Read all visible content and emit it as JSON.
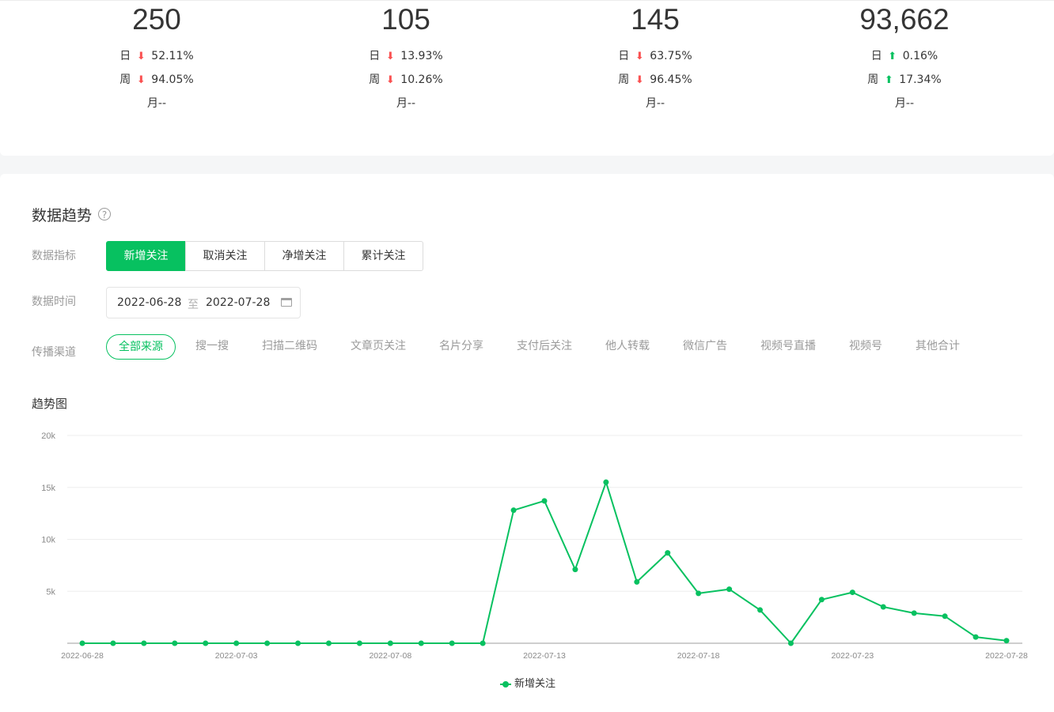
{
  "stats": [
    {
      "value": "250",
      "day_label": "日",
      "day_dir": "down",
      "day_pct": "52.11%",
      "week_label": "周",
      "week_dir": "down",
      "week_pct": "94.05%",
      "month": "月--"
    },
    {
      "value": "105",
      "day_label": "日",
      "day_dir": "down",
      "day_pct": "13.93%",
      "week_label": "周",
      "week_dir": "down",
      "week_pct": "10.26%",
      "month": "月--"
    },
    {
      "value": "145",
      "day_label": "日",
      "day_dir": "down",
      "day_pct": "63.75%",
      "week_label": "周",
      "week_dir": "down",
      "week_pct": "96.45%",
      "month": "月--"
    },
    {
      "value": "93,662",
      "day_label": "日",
      "day_dir": "up",
      "day_pct": "0.16%",
      "week_label": "周",
      "week_dir": "up",
      "week_pct": "17.34%",
      "month": "月--"
    }
  ],
  "trend": {
    "title": "数据趋势",
    "help_icon": "question-circle-icon",
    "metric_label": "数据指标",
    "metrics": [
      "新增关注",
      "取消关注",
      "净增关注",
      "累计关注"
    ],
    "active_metric": 0,
    "time_label": "数据时间",
    "date_start": "2022-06-28",
    "date_sep": "至",
    "date_end": "2022-07-28",
    "calendar_icon": "calendar-icon",
    "channel_label": "传播渠道",
    "channels": [
      "全部来源",
      "搜一搜",
      "扫描二维码",
      "文章页关注",
      "名片分享",
      "支付后关注",
      "他人转载",
      "微信广告",
      "视频号直播",
      "视频号",
      "其他合计"
    ],
    "active_channel": 0,
    "chart_title": "趋势图"
  },
  "colors": {
    "accent": "#07c160",
    "down": "#fa5151",
    "up": "#07c160"
  },
  "chart_data": {
    "type": "line",
    "title": "趋势图",
    "xlabel": "",
    "ylabel": "",
    "ylim": [
      0,
      20000
    ],
    "yticks": [
      "5k",
      "10k",
      "15k",
      "20k"
    ],
    "ytick_values": [
      5000,
      10000,
      15000,
      20000
    ],
    "xtick_labels": [
      "2022-06-28",
      "2022-07-03",
      "2022-07-08",
      "2022-07-13",
      "2022-07-18",
      "2022-07-23",
      "2022-07-28"
    ],
    "x": [
      "2022-06-28",
      "2022-06-29",
      "2022-06-30",
      "2022-07-01",
      "2022-07-02",
      "2022-07-03",
      "2022-07-04",
      "2022-07-05",
      "2022-07-06",
      "2022-07-07",
      "2022-07-08",
      "2022-07-09",
      "2022-07-10",
      "2022-07-11",
      "2022-07-12",
      "2022-07-13",
      "2022-07-14",
      "2022-07-15",
      "2022-07-16",
      "2022-07-17",
      "2022-07-18",
      "2022-07-19",
      "2022-07-20",
      "2022-07-21",
      "2022-07-22",
      "2022-07-23",
      "2022-07-24",
      "2022-07-25",
      "2022-07-26",
      "2022-07-27",
      "2022-07-28"
    ],
    "series": [
      {
        "name": "新增关注",
        "color": "#07c160",
        "values": [
          0,
          0,
          0,
          0,
          0,
          0,
          0,
          0,
          0,
          0,
          0,
          0,
          0,
          0,
          12800,
          13700,
          7100,
          15500,
          5900,
          8700,
          4800,
          5200,
          3200,
          0,
          4200,
          4900,
          3500,
          2900,
          2600,
          600,
          250
        ]
      }
    ],
    "grid": true,
    "legend_position": "bottom-center"
  }
}
